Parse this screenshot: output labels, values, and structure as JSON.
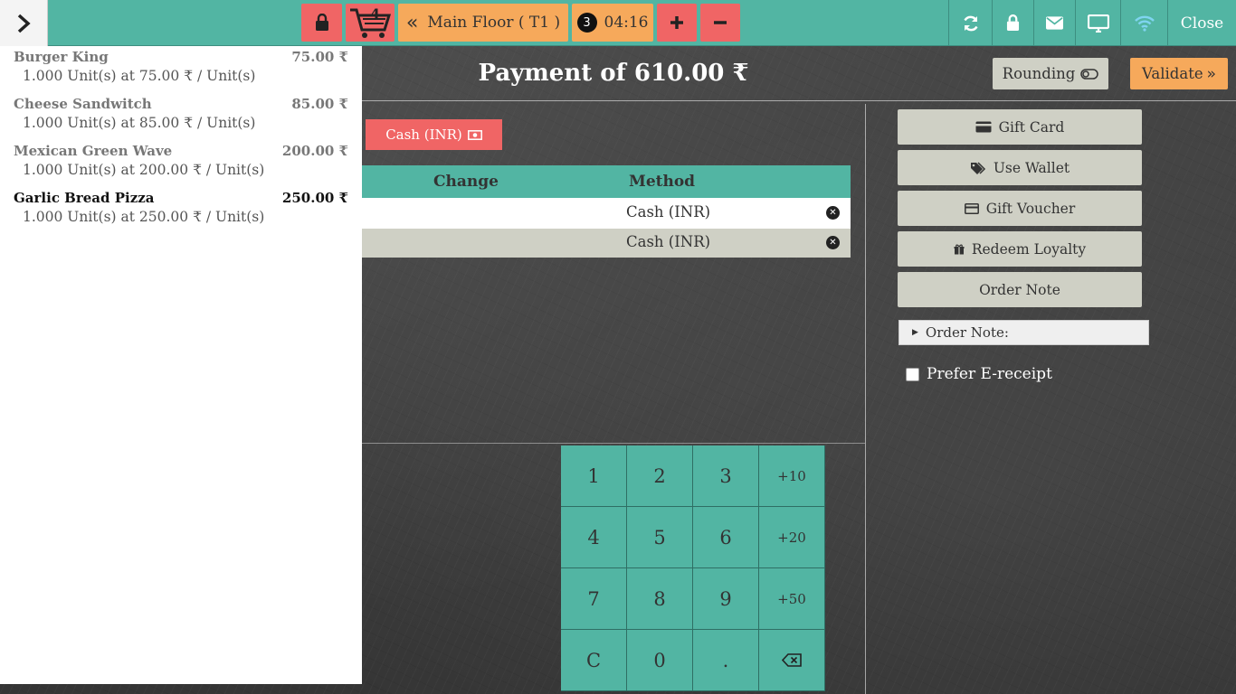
{
  "topbar": {
    "cart_count": "4",
    "floor_label": "Main Floor ( T1 )",
    "orders_badge": "3",
    "orders_time": "04:16",
    "close_label": "Close",
    "colors": {
      "bar": "#52b5a3",
      "red": "#f06565",
      "orange": "#f6a95b"
    }
  },
  "order_lines": [
    {
      "name": "Burger King",
      "price": "75.00 ₹",
      "qty": "1.000 Unit(s) at 75.00 ₹ / Unit(s)"
    },
    {
      "name": "Cheese Sandwitch",
      "price": "85.00 ₹",
      "qty": "1.000 Unit(s) at 85.00 ₹ / Unit(s)"
    },
    {
      "name": "Mexican Green Wave",
      "price": "200.00 ₹",
      "qty": "1.000 Unit(s) at 200.00 ₹ / Unit(s)"
    },
    {
      "name": "Garlic Bread Pizza",
      "price": "250.00 ₹",
      "qty": "1.000 Unit(s) at 250.00 ₹ / Unit(s)"
    }
  ],
  "payment": {
    "title": "Payment of 610.00 ₹",
    "rounding_label": "Rounding",
    "validate_label": "Validate",
    "method_button": "Cash (INR)",
    "table": {
      "headers": {
        "change": "Change",
        "method": "Method"
      },
      "rows": [
        {
          "method": "Cash (INR)"
        },
        {
          "method": "Cash (INR)"
        }
      ]
    }
  },
  "numpad": [
    "1",
    "2",
    "3",
    "+10",
    "4",
    "5",
    "6",
    "+20",
    "7",
    "8",
    "9",
    "+50",
    "C",
    "0",
    "."
  ],
  "actions": {
    "gift_card": "Gift Card",
    "use_wallet": "Use Wallet",
    "gift_voucher": "Gift Voucher",
    "redeem_loyalty": "Redeem Loyalty",
    "order_note": "Order Note",
    "order_note_field": "Order Note:",
    "prefer_ereceipt": "Prefer E-receipt"
  }
}
